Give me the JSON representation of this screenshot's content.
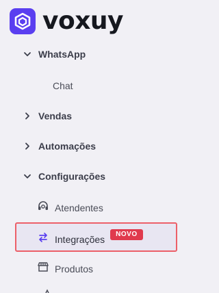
{
  "brand": {
    "name": "voxuy",
    "color": "#5a3ff0"
  },
  "nav": {
    "whatsapp": {
      "label": "WhatsApp",
      "expanded": true,
      "children": {
        "chat": "Chat"
      }
    },
    "vendas": {
      "label": "Vendas",
      "expanded": false
    },
    "automacoes": {
      "label": "Automações",
      "expanded": false
    },
    "configuracoes": {
      "label": "Configurações",
      "expanded": true,
      "children": {
        "atendentes": {
          "label": "Atendentes",
          "icon": "headset-icon"
        },
        "integracoes": {
          "label": "Integrações",
          "icon": "swap-arrows-icon",
          "badge": "NOVO",
          "highlighted": true
        },
        "produtos": {
          "label": "Produtos",
          "icon": "store-icon"
        }
      }
    }
  },
  "colors": {
    "badge": "#e03a4d",
    "highlight_border": "#ec5f68",
    "icon_accent": "#5a3ff0"
  }
}
